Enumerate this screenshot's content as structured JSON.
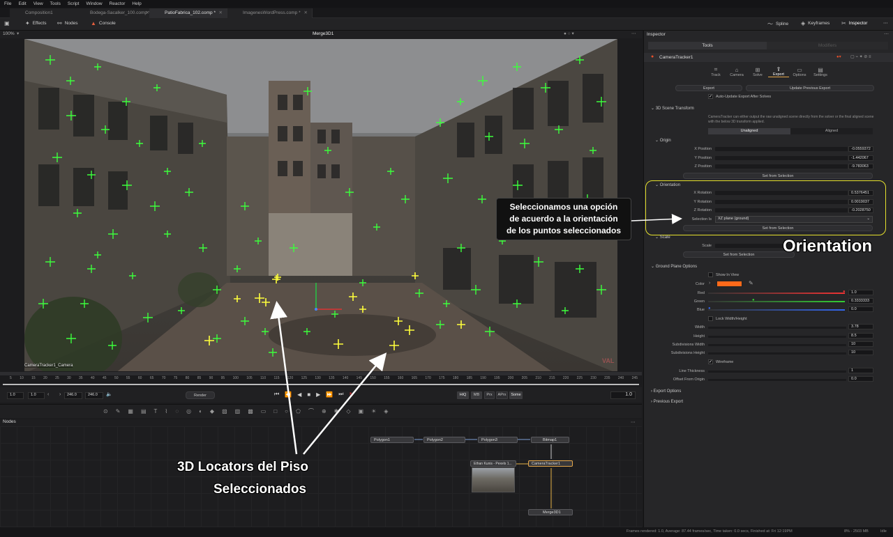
{
  "menu": [
    "File",
    "Edit",
    "View",
    "Tools",
    "Script",
    "Window",
    "Reactor",
    "Help"
  ],
  "tabs": [
    {
      "label": "Composition1"
    },
    {
      "label": "Bodega-Sacalker_100.comp *"
    },
    {
      "label": "PatioFabrica_102.comp *"
    },
    {
      "label": "ImagenesWordPress.comp *"
    }
  ],
  "toolbar": {
    "effects": "Effects",
    "nodes": "Nodes",
    "console": "Console",
    "spline": "Spline",
    "keyframes": "Keyframes",
    "inspector": "Inspector"
  },
  "viewer": {
    "zoom": "100%",
    "title": "Merge3D1",
    "camera_label": "CameraTracker1_Camera",
    "watermark": "VAL",
    "accent_green": "#3cff3c",
    "accent_yellow": "#ffff3c"
  },
  "timeline": {
    "ticks": [
      "5",
      "10",
      "15",
      "20",
      "25",
      "30",
      "35",
      "40",
      "45",
      "50",
      "55",
      "60",
      "65",
      "70",
      "75",
      "80",
      "85",
      "90",
      "95",
      "100",
      "105",
      "110",
      "115",
      "120",
      "125",
      "130",
      "135",
      "140",
      "145",
      "150",
      "155",
      "160",
      "165",
      "170",
      "175",
      "180",
      "185",
      "190",
      "195",
      "200",
      "205",
      "210",
      "215",
      "220",
      "225",
      "230",
      "235",
      "240",
      "245"
    ]
  },
  "transport": {
    "start": "1.0",
    "render_start": "1.0",
    "render_end": "246.0",
    "end": "246.0",
    "render": "Render",
    "hiq": "HiQ",
    "mb": "MB",
    "prx": "Prx",
    "aprx": "APrx",
    "some": "Some",
    "current": "1.0"
  },
  "nodes": {
    "title": "Nodes",
    "items": [
      {
        "label": "Polygon1"
      },
      {
        "label": "Polygon2"
      },
      {
        "label": "Polygon3"
      },
      {
        "label": "Bitmap1"
      },
      {
        "label": "Ethan Kunis - Pexels 1..."
      },
      {
        "label": "CameraTracker1"
      },
      {
        "label": "Merge3D1"
      }
    ]
  },
  "status": {
    "left": "Frames rendered: 1.0,  Average: 87.44 frames/sec,  Time taken: 0.0 secs,  Finished at: Fri 12:19PM",
    "memory": "8% - 2503 MB",
    "state": "Idle"
  },
  "inspector": {
    "title": "Inspector",
    "tab_tools": "Tools",
    "tab_modifiers": "Modifiers",
    "node_name": "CameraTracker1",
    "subtabs": [
      "Track",
      "Camera",
      "Solve",
      "Export",
      "Options",
      "Settings"
    ],
    "export_btn": "Export",
    "update_btn": "Update Previous Export",
    "auto_update": "Auto-Update Export After Solves",
    "scene_transform": "3D Scene Transform",
    "desc": "CameraTracker can either output the raw unaligned scene directly from the solver or the final aligned scene with the below 3D transform applied.",
    "unaligned": "Unaligned",
    "aligned": "Aligned",
    "origin": "Origin",
    "x_pos_label": "X Position",
    "x_pos": "-0.0559372",
    "y_pos_label": "Y Position",
    "y_pos": "-1.442067",
    "z_pos_label": "Z Position",
    "z_pos": "-9.783063",
    "set_from_selection": "Set from Selection",
    "orientation": "Orientation",
    "x_rot_label": "X Rotation",
    "x_rot": "0.5376451",
    "y_rot_label": "Y Rotation",
    "y_rot": "0.0019037",
    "z_rot_label": "Z Rotation",
    "z_rot": "-0.2028750",
    "selection_is_label": "Selection Is",
    "selection_is": "XZ plane (ground)",
    "scale_section": "Scale",
    "scale_label": "Scale",
    "ground_plane": "Ground Plane Options",
    "show_in_view": "Show In View",
    "color_label": "Color",
    "color_hex": "#ff6a1a",
    "red_label": "Red",
    "red": "1.0",
    "green_label": "Green",
    "green": "0.3333333",
    "blue_label": "Blue",
    "blue": "0.0",
    "lock_wh": "Lock Width/Height",
    "width_label": "Width",
    "width": "3.78",
    "height_label": "Height",
    "height": "8.5",
    "sub_w_label": "Subdivisions Width",
    "sub_w": "10",
    "sub_h_label": "Subdivisions Height",
    "sub_h": "10",
    "wireframe": "Wireframe",
    "line_thickness_label": "Line Thickness",
    "line_thickness": "1",
    "offset_label": "Offset From Origin",
    "offset": "0.0",
    "export_options": "Export Options",
    "previous_export": "Previous Export"
  },
  "annotations": {
    "callout_line1": "Seleccionamos una opción",
    "callout_line2": "de acuerdo a la orientación",
    "callout_line3": "de los puntos seleccionados",
    "orientation_big": "Orientation",
    "locators_line1": "3D Locators del Piso",
    "locators_line2": "Seleccionados"
  }
}
